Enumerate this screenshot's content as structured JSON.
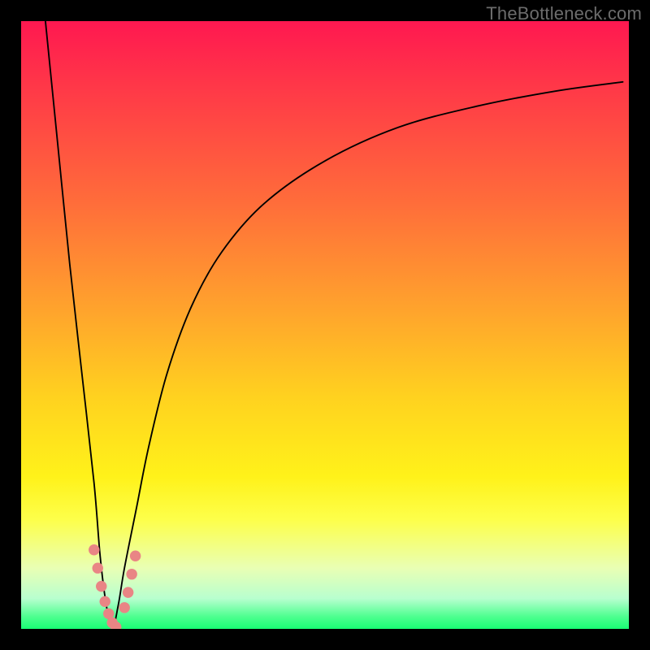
{
  "watermark": "TheBottleneck.com",
  "chart_data": {
    "type": "line",
    "title": "",
    "xlabel": "",
    "ylabel": "",
    "xlim": [
      0,
      100
    ],
    "ylim": [
      0,
      100
    ],
    "grid": false,
    "legend": false,
    "gradient_stops": [
      {
        "pct": 0,
        "color": "#ff1850"
      },
      {
        "pct": 12,
        "color": "#ff3b47"
      },
      {
        "pct": 30,
        "color": "#ff6d3a"
      },
      {
        "pct": 48,
        "color": "#ffa52c"
      },
      {
        "pct": 62,
        "color": "#ffd21f"
      },
      {
        "pct": 75,
        "color": "#fff21a"
      },
      {
        "pct": 82,
        "color": "#fdff4a"
      },
      {
        "pct": 90,
        "color": "#e9ffb4"
      },
      {
        "pct": 95,
        "color": "#b8ffcf"
      },
      {
        "pct": 98,
        "color": "#4dff8f"
      },
      {
        "pct": 100,
        "color": "#19ff74"
      }
    ],
    "series": [
      {
        "name": "bottleneck-curve",
        "color": "#000000",
        "x": [
          4,
          6,
          8,
          10,
          12,
          13,
          14,
          15,
          16,
          17,
          19,
          21,
          24,
          28,
          33,
          40,
          50,
          62,
          75,
          88,
          99
        ],
        "y": [
          100,
          80,
          60,
          42,
          24,
          12,
          4,
          0,
          4,
          10,
          20,
          30,
          42,
          53,
          62,
          70,
          77,
          82.5,
          86,
          88.5,
          90
        ]
      }
    ],
    "markers": {
      "name": "dip-markers",
      "color": "#e98585",
      "size": 5,
      "x": [
        12.0,
        12.6,
        13.2,
        13.8,
        14.4,
        15.0,
        15.6,
        17.0,
        17.6,
        18.2,
        18.8
      ],
      "y": [
        13.0,
        10.0,
        7.0,
        4.5,
        2.5,
        1.0,
        0.3,
        3.5,
        6.0,
        9.0,
        12.0
      ]
    }
  }
}
